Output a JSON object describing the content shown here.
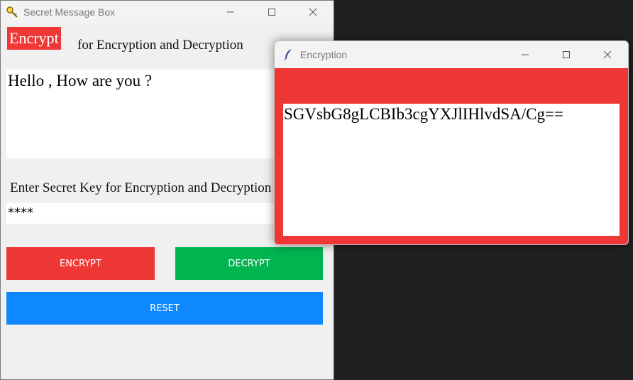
{
  "main_window": {
    "title": "Secret Message Box",
    "icon": "magnifier-key-icon",
    "badge": "Encrypt",
    "intro": "for Encryption and Decryption",
    "message": "Hello , How are you ?",
    "key_label": "Enter Secret Key for Encryption and Decryption",
    "key_value": "****",
    "buttons": {
      "encrypt": "ENCRYPT",
      "decrypt": "DECRYPT",
      "reset": "RESET"
    }
  },
  "popup_window": {
    "title": "Encryption",
    "icon": "feather-icon",
    "output": "SGVsbG8gLCBIb3cgYXJlIHlvdSA/Cg=="
  },
  "colors": {
    "encrypt": "#ef3836",
    "decrypt": "#00b450",
    "reset": "#0f88ff",
    "background": "#202020"
  }
}
